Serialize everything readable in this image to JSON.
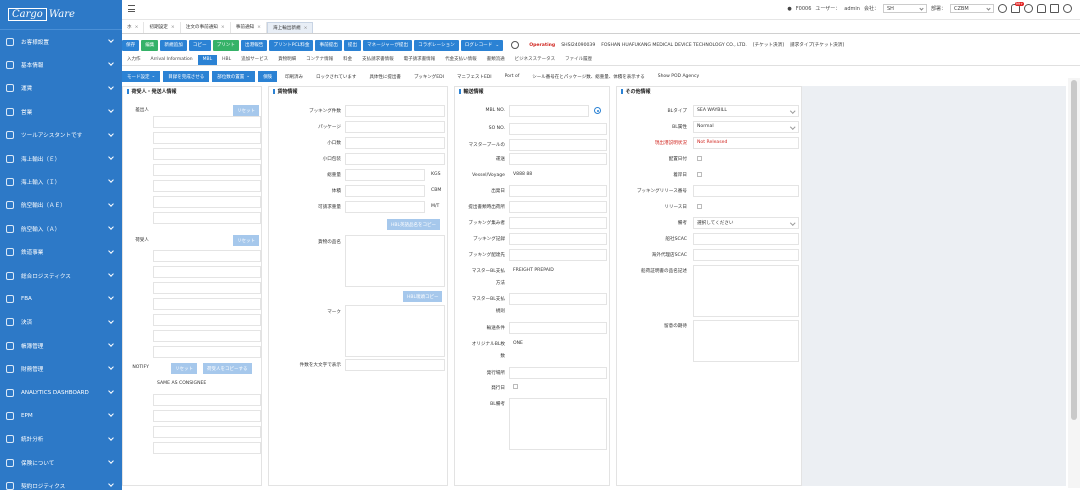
{
  "app": {
    "logo_line1": "Cargo",
    "logo_line2": "Ware"
  },
  "sidebar": {
    "items": [
      {
        "label": "お客様設置",
        "icon": "customer-icon"
      },
      {
        "label": "基本情報",
        "icon": "info-icon"
      },
      {
        "label": "運賃",
        "icon": "fare-icon"
      },
      {
        "label": "営業",
        "icon": "sales-icon"
      },
      {
        "label": "ツールアシスタントです",
        "icon": "tool-icon"
      },
      {
        "label": "海上輸出（Ｅ）",
        "icon": "ship-export-icon"
      },
      {
        "label": "海上輸入（Ｉ）",
        "icon": "ship-import-icon"
      },
      {
        "label": "航空輸出（ＡＥ）",
        "icon": "air-export-icon"
      },
      {
        "label": "航空輸入（Ａ）",
        "icon": "air-import-icon"
      },
      {
        "label": "鉄道事業",
        "icon": "rail-icon"
      },
      {
        "label": "総合ロジスティクス",
        "icon": "logistics-icon"
      },
      {
        "label": "FBA",
        "icon": "fba-icon"
      },
      {
        "label": "決済",
        "icon": "payment-icon"
      },
      {
        "label": "帳簿管理",
        "icon": "ledger-icon"
      },
      {
        "label": "財務管理",
        "icon": "finance-icon"
      },
      {
        "label": "ANALYTICS DASHBOARD",
        "icon": "dashboard-icon"
      },
      {
        "label": "EPM",
        "icon": "epm-icon"
      },
      {
        "label": "統計分析",
        "icon": "stats-icon"
      },
      {
        "label": "保険について",
        "icon": "insurance-icon"
      },
      {
        "label": "契約ロジティクス",
        "icon": "contract-icon"
      }
    ]
  },
  "topbar": {
    "user_code": "F0006",
    "user_label": "ユーザー：",
    "user_value": "admin",
    "company_label": "会社：",
    "company_value": "SH",
    "dept_label": "部署：",
    "dept_value": "CZBM",
    "notif_count": "99+"
  },
  "tabs": [
    {
      "label": "ホ"
    },
    {
      "label": "初期設定"
    },
    {
      "label": "注文の事前通知"
    },
    {
      "label": "事前通知"
    },
    {
      "label": "海上輸出新規",
      "active": true
    }
  ],
  "actions": {
    "buttons": [
      {
        "label": "保存"
      },
      {
        "label": "編集",
        "style": "green"
      },
      {
        "label": "新規追加"
      },
      {
        "label": "コピー"
      },
      {
        "label": "プリント",
        "style": "green"
      },
      {
        "label": "出港報告"
      },
      {
        "label": "プリントPCL料金"
      },
      {
        "label": "事前提出"
      },
      {
        "label": "提出"
      },
      {
        "label": "マネージャーが提出"
      },
      {
        "label": "コラボレーション"
      },
      {
        "label": "ログレコード"
      }
    ],
    "status": "Operating",
    "job_no": "SHSI24090039",
    "company": "FOSHAN HUAFUKANG MEDICAL DEVICE TECHNOLOGY CO., LTD.",
    "ticket": "[チケット決済]",
    "ticket_type": "請求タイプ[チケット決済]"
  },
  "subtabs": [
    "入力作",
    "Arrival Information",
    "MBL",
    "HBL",
    "追加サービス",
    "貨物明細",
    "コンテナ情報",
    "料金",
    "支払請求書情報",
    "電子請求書情報",
    "代金支払い情報",
    "書類流通",
    "ビジネスステータス",
    "ファイル履歴"
  ],
  "tools": {
    "buttons": [
      {
        "label": "モード設定",
        "dd": true
      },
      {
        "label": "目録を完成させる"
      },
      {
        "label": "部位数の置置",
        "dd": true
      },
      {
        "label": "保険"
      }
    ],
    "links": [
      "印刷済み",
      "ロックされています",
      "具体性に提出書",
      "ブッキングEDI",
      "マニフェストEDI",
      "Port of",
      "シール番号在とパッケージ数、総重量、体積を表示する",
      "Show POD Agency"
    ]
  },
  "panel1": {
    "title": "荷受人・発送人情報",
    "shipper_label": "差出人",
    "consignee_label": "荷受人",
    "notify_label": "NOTIFY",
    "reset": "リセット",
    "copy_consignee": "荷受人をコピーする",
    "notify_value": "SAME AS CONSIGNEE"
  },
  "panel2": {
    "title": "貨物情報",
    "labels": {
      "booking_count": "ブッキング件数",
      "package": "パッケージ",
      "small_qty": "小口数",
      "small_pkg": "小口包装",
      "gross_weight": "総重量",
      "volume": "体積",
      "billing_weight": "可請求重量",
      "cargo_name": "貨物の品名",
      "mark": "マーク",
      "print_upper": "件数を大文字で表示"
    },
    "units": {
      "kgs": "KGS",
      "cbm": "CBM",
      "mt": "M/T"
    },
    "copy_hbl_name": "HBL英語品名をコピー",
    "copy_hbl_mark": "HBL唛頭コピー"
  },
  "panel3": {
    "title": "輸送情報",
    "labels": {
      "mbl": "MBL NO.",
      "so": "SO NO.",
      "master_pool": "マスタープールの",
      "carrier": "運送",
      "vessel": "Vessel/Voyage",
      "departure": "出発日",
      "port_loading": "提出書類時出荷所",
      "booking_agent": "ブッキング集み者",
      "booking_note": "ブッキング記録",
      "booking_dest": "ブッキング配達先",
      "master_payment": "マスターBL支払",
      "method": "方法",
      "master_payment2": "マスターBL支払",
      "method2": "規則",
      "transport": "輸送条件",
      "original_count": "オリジナルBL枚",
      "count": "数",
      "issue_place": "発行場所",
      "issue_date": "発行日",
      "bl_remark": "BL備考"
    },
    "vessel_value": "V888 88",
    "payment_value": "FREIGHT PREPAID",
    "original_value": "ONE"
  },
  "panel4": {
    "title": "その他情報",
    "labels": {
      "bl_type": "BLタイプ",
      "bl_attr": "BL属性",
      "release_status": "現出港説明状況",
      "stacking_date": "配置日付",
      "vessel_date": "着岸日",
      "booking_release": "ブッキングリリース番号",
      "release_date": "リリース日",
      "remark": "備考",
      "origin_scac": "船社SCAC",
      "agent_scac": "海外代理店SCAC",
      "bl_notice": "船荷証明書の品名記述",
      "notice_date": "留意の期待"
    },
    "bl_type_value": "SEA WAYBILL",
    "bl_attr_value": "Normal",
    "release_value": "Not Released",
    "remark_placeholder": "選択してください"
  }
}
